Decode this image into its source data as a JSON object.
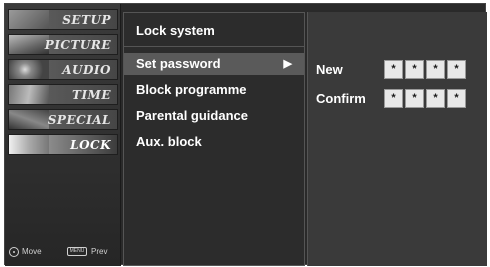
{
  "sidebar": {
    "categories": [
      {
        "label": "SETUP",
        "icon": "setup-icon"
      },
      {
        "label": "PICTURE",
        "icon": "picture-icon"
      },
      {
        "label": "AUDIO",
        "icon": "audio-icon"
      },
      {
        "label": "TIME",
        "icon": "time-icon"
      },
      {
        "label": "SPECIAL",
        "icon": "special-icon"
      },
      {
        "label": "LOCK",
        "icon": "lock-icon"
      }
    ],
    "active": "LOCK",
    "footer": {
      "move_label": "Move",
      "menu_key_label": "MENU",
      "prev_label": "Prev"
    }
  },
  "menu": {
    "title": "Lock system",
    "items": [
      {
        "label": "Set password",
        "selected": true,
        "arrow": "▶"
      },
      {
        "label": "Block programme"
      },
      {
        "label": "Parental guidance"
      },
      {
        "label": "Aux. block"
      }
    ]
  },
  "password_panel": {
    "new_label": "New",
    "confirm_label": "Confirm",
    "new_digits": [
      "*",
      "*",
      "*",
      "*"
    ],
    "confirm_digits": [
      "*",
      "*",
      "*",
      "*"
    ]
  },
  "colors": {
    "background": "#2a2a2a",
    "selected_item": "#5a5a5a",
    "panel": "#3a3a3a"
  }
}
